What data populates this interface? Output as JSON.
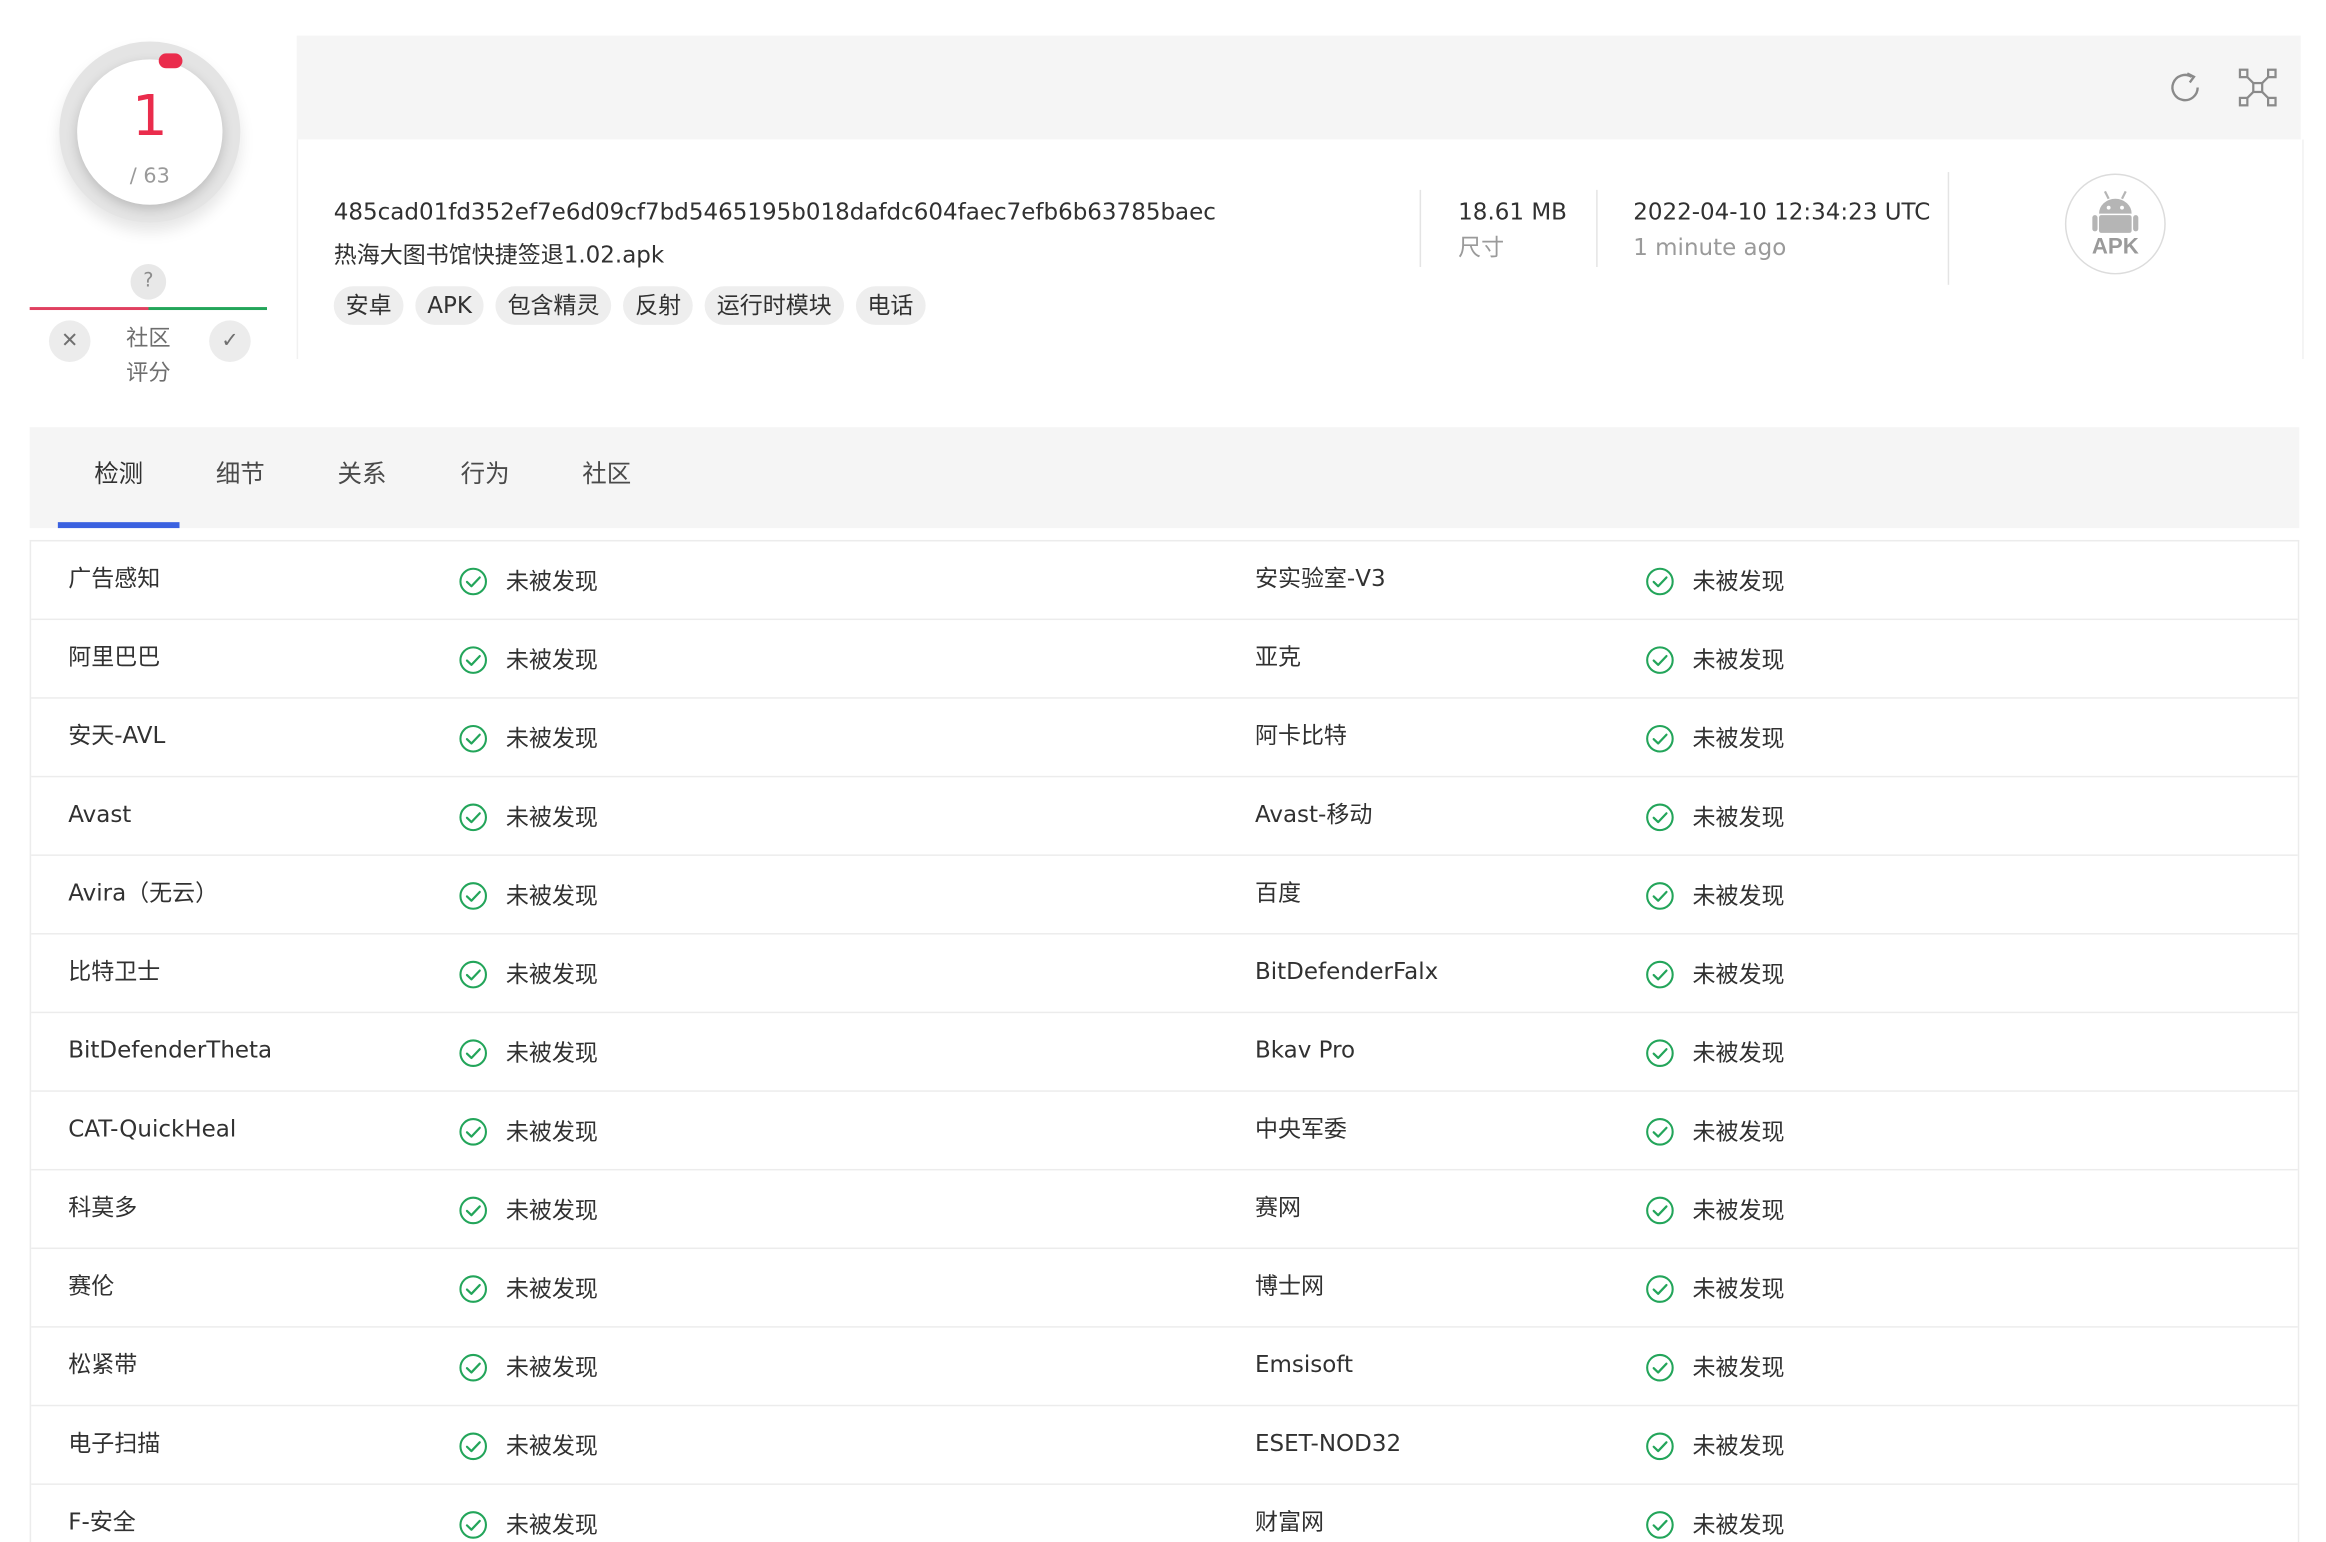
{
  "score": {
    "positives": "1",
    "total": "/ 63"
  },
  "community": {
    "question_mark": "?",
    "label": "社区\n评分",
    "vote_down_glyph": "✕",
    "vote_up_glyph": "✓"
  },
  "file": {
    "hash": "485cad01fd352ef7e6d09cf7bd5465195b018dafdc604faec7efb6b63785baec",
    "name": "热海大图书馆快捷签退1.02.apk",
    "tags": [
      "安卓",
      "APK",
      "包含精灵",
      "反射",
      "运行时模块",
      "电话"
    ],
    "size_value": "18.61 MB",
    "size_label": "尺寸",
    "date_value": "2022-04-10 12:34:23 UTC",
    "date_relative": "1 minute ago",
    "type_badge": "APK"
  },
  "toolbar": {
    "reanalyze_icon": "reanalyze-icon",
    "graph_icon": "graph-icon"
  },
  "tabs": [
    "检测",
    "细节",
    "关系",
    "行为",
    "社区"
  ],
  "active_tab": 0,
  "colors": {
    "accent": "#3a61e0",
    "positive": "#ea2c4c",
    "clean": "#23a55a"
  },
  "detections": [
    {
      "left_engine": "广告感知",
      "left_result": "未被发现",
      "right_engine": "安实验室-V3",
      "right_result": "未被发现"
    },
    {
      "left_engine": "阿里巴巴",
      "left_result": "未被发现",
      "right_engine": "亚克",
      "right_result": "未被发现"
    },
    {
      "left_engine": "安天-AVL",
      "left_result": "未被发现",
      "right_engine": "阿卡比特",
      "right_result": "未被发现"
    },
    {
      "left_engine": "Avast",
      "left_result": "未被发现",
      "right_engine": "Avast-移动",
      "right_result": "未被发现"
    },
    {
      "left_engine": "Avira（无云）",
      "left_result": "未被发现",
      "right_engine": "百度",
      "right_result": "未被发现"
    },
    {
      "left_engine": "比特卫士",
      "left_result": "未被发现",
      "right_engine": "BitDefenderFalx",
      "right_result": "未被发现"
    },
    {
      "left_engine": "BitDefenderTheta",
      "left_result": "未被发现",
      "right_engine": "Bkav Pro",
      "right_result": "未被发现"
    },
    {
      "left_engine": "CAT-QuickHeal",
      "left_result": "未被发现",
      "right_engine": "中央军委",
      "right_result": "未被发现"
    },
    {
      "left_engine": "科莫多",
      "left_result": "未被发现",
      "right_engine": "赛网",
      "right_result": "未被发现"
    },
    {
      "left_engine": "赛伦",
      "left_result": "未被发现",
      "right_engine": "博士网",
      "right_result": "未被发现"
    },
    {
      "left_engine": "松紧带",
      "left_result": "未被发现",
      "right_engine": "Emsisoft",
      "right_result": "未被发现"
    },
    {
      "left_engine": "电子扫描",
      "left_result": "未被发现",
      "right_engine": "ESET-NOD32",
      "right_result": "未被发现"
    },
    {
      "left_engine": "F-安全",
      "left_result": "未被发现",
      "right_engine": "财富网",
      "right_result": "未被发现"
    }
  ]
}
